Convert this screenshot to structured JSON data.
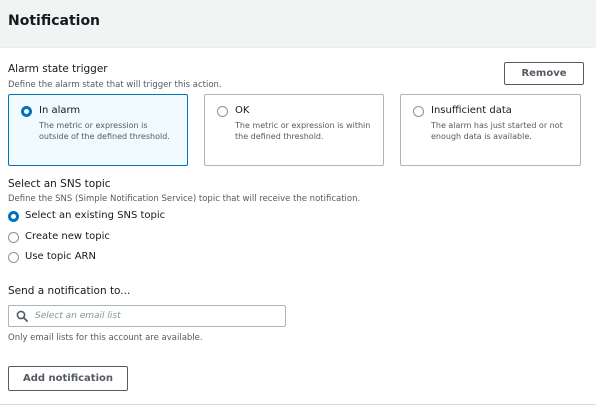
{
  "header": {
    "title": "Notification"
  },
  "alarm_state": {
    "label": "Alarm state trigger",
    "description": "Define the alarm state that will trigger this action.",
    "remove_label": "Remove",
    "options": [
      {
        "title": "In alarm",
        "description": "The metric or expression is outside of the defined threshold.",
        "selected": true
      },
      {
        "title": "OK",
        "description": "The metric or expression is within the defined threshold.",
        "selected": false
      },
      {
        "title": "Insufficient data",
        "description": "The alarm has just started or not enough data is available.",
        "selected": false
      }
    ]
  },
  "sns_topic": {
    "label": "Select an SNS topic",
    "description": "Define the SNS (Simple Notification Service) topic that will receive the notification.",
    "options": [
      {
        "label": "Select an existing SNS topic",
        "selected": true
      },
      {
        "label": "Create new topic",
        "selected": false
      },
      {
        "label": "Use topic ARN",
        "selected": false
      }
    ]
  },
  "send_to": {
    "label": "Send a notification to...",
    "placeholder": "Select an email list",
    "hint": "Only email lists for this account are available.",
    "search_icon": "search-icon"
  },
  "add_notification_label": "Add notification",
  "colors": {
    "accent": "#0073bb",
    "selected_bg": "#f1faff",
    "header_bg": "#f2f3f3"
  }
}
